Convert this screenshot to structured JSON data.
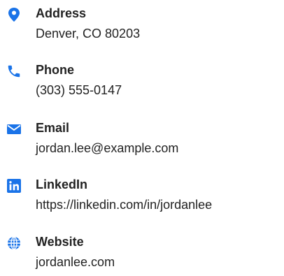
{
  "accent_color": "#1a73e8",
  "contacts": [
    {
      "icon": "map-pin-icon",
      "label": "Address",
      "value": "Denver, CO 80203"
    },
    {
      "icon": "phone-icon",
      "label": "Phone",
      "value": "(303) 555-0147"
    },
    {
      "icon": "envelope-icon",
      "label": "Email",
      "value": "jordan.lee@example.com"
    },
    {
      "icon": "linkedin-icon",
      "label": "LinkedIn",
      "value": "https://linkedin.com/in/jordanlee"
    },
    {
      "icon": "globe-icon",
      "label": "Website",
      "value": "jordanlee.com"
    }
  ]
}
